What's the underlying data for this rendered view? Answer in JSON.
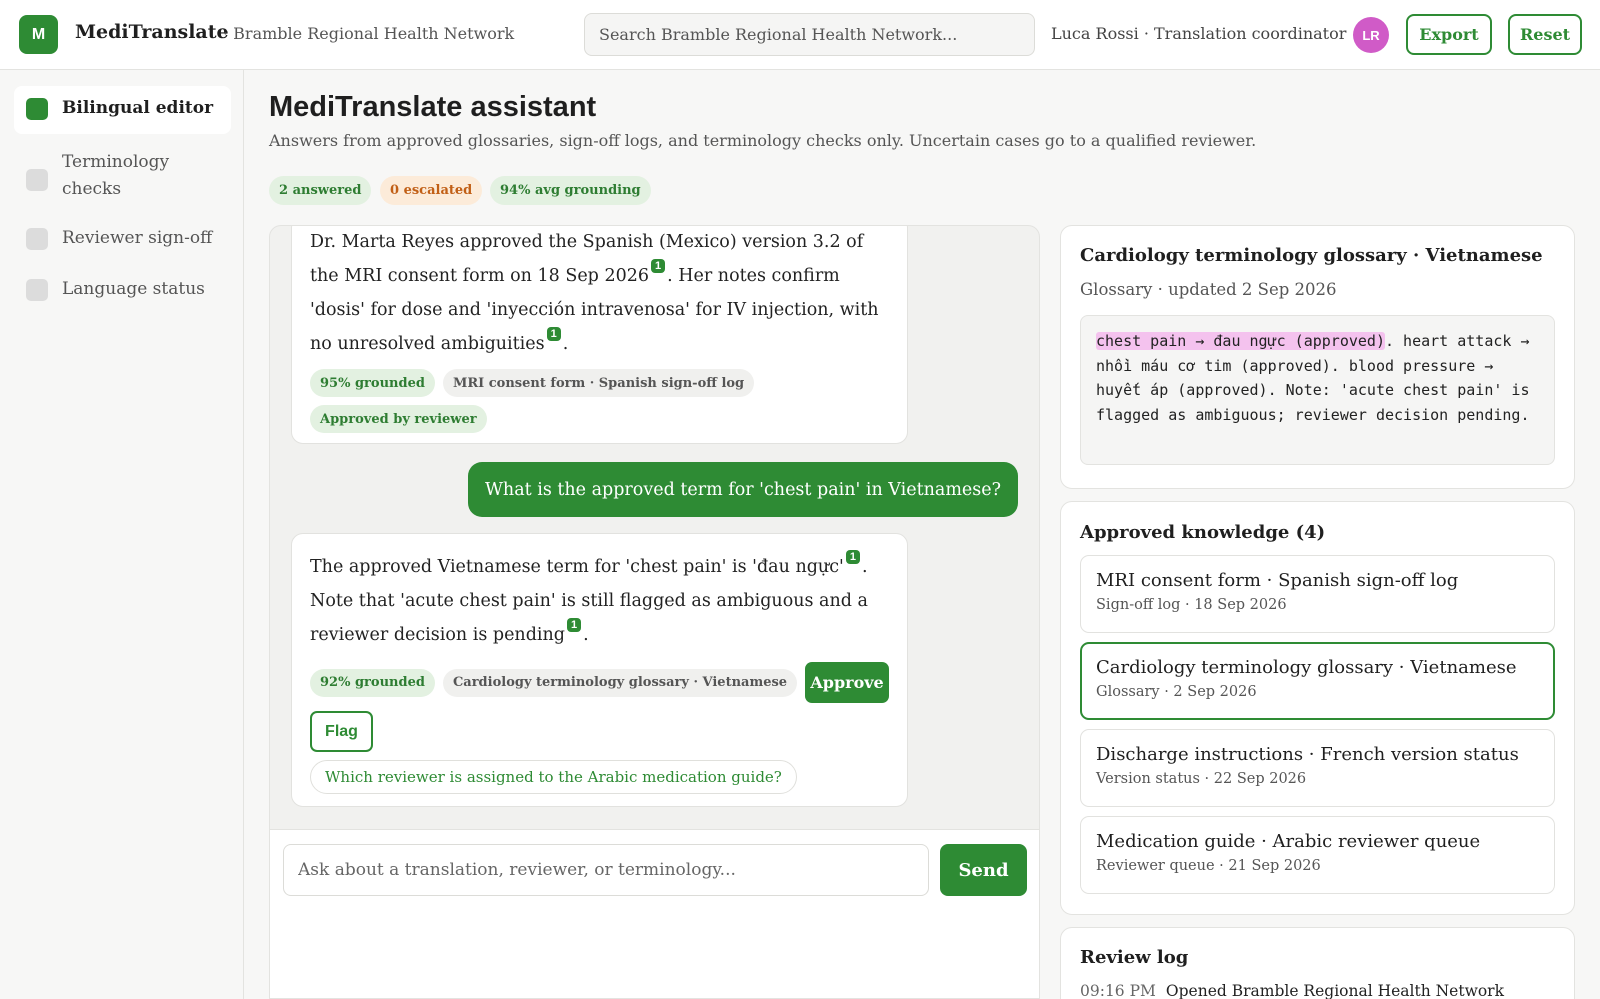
{
  "topbar": {
    "logo_letter": "M",
    "app_name": "MediTranslate",
    "org_name": "· Bramble Regional Health Network",
    "search_placeholder": "Search Bramble Regional Health Network...",
    "user_label": "Luca Rossi · Translation coordinator",
    "avatar_initials": "LR",
    "export_label": "Export",
    "reset_label": "Reset"
  },
  "sidebar": {
    "items": [
      {
        "label": "Bilingual editor",
        "active": true
      },
      {
        "label": "Terminology checks",
        "active": false
      },
      {
        "label": "Reviewer sign-off",
        "active": false
      },
      {
        "label": "Language status",
        "active": false
      }
    ]
  },
  "header": {
    "title": "MediTranslate assistant",
    "subtitle": "Answers from approved glossaries, sign-off logs, and terminology checks only. Uncertain cases go to a qualified reviewer.",
    "stats": {
      "answered": "2 answered",
      "escalated": "0 escalated",
      "grounding": "94% avg grounding"
    }
  },
  "chat": {
    "msg1": {
      "part1": "Dr. Marta Reyes approved the Spanish (Mexico) version 3.2 of the MRI consent form on 18 Sep 2026",
      "cite1": "1",
      "part2": ". Her notes confirm 'dosis' for dose and 'inyección intravenosa' for IV injection, with no unresolved ambiguities",
      "cite2": "1",
      "part3": ".",
      "grounded": "95% grounded",
      "source": "MRI consent form · Spanish sign-off log",
      "status": "Approved by reviewer"
    },
    "user_question": "What is the approved term for 'chest pain' in Vietnamese?",
    "msg2": {
      "part1": "The approved Vietnamese term for 'chest pain' is 'đau ngực'",
      "cite1": "1",
      "part2": ". Note that 'acute chest pain' is still flagged as ambiguous and a reviewer decision is pending",
      "cite2": "1",
      "part3": ".",
      "grounded": "92% grounded",
      "source": "Cardiology terminology glossary · Vietnamese",
      "approve_label": "Approve",
      "flag_label": "Flag",
      "suggestion": "Which reviewer is assigned to the Arabic medication guide?"
    },
    "composer_placeholder": "Ask about a translation, reviewer, or terminology...",
    "send_label": "Send"
  },
  "glossary_card": {
    "title": "Cardiology terminology glossary · Vietnamese",
    "subtitle": "Glossary · updated 2 Sep 2026",
    "highlight": "chest pain → đau ngực (approved)",
    "rest": ". heart attack → nhồi máu cơ tim (approved). blood pressure → huyết áp (approved). Note: 'acute chest pain' is flagged as ambiguous; reviewer decision pending."
  },
  "knowledge": {
    "title": "Approved knowledge (4)",
    "items": [
      {
        "title": "MRI consent form · Spanish sign-off log",
        "meta": "Sign-off log · 18 Sep 2026",
        "selected": false
      },
      {
        "title": "Cardiology terminology glossary · Vietnamese",
        "meta": "Glossary · 2 Sep 2026",
        "selected": true
      },
      {
        "title": "Discharge instructions · French version status",
        "meta": "Version status · 22 Sep 2026",
        "selected": false
      },
      {
        "title": "Medication guide · Arabic reviewer queue",
        "meta": "Reviewer queue · 21 Sep 2026",
        "selected": false
      }
    ]
  },
  "review_log": {
    "title": "Review log",
    "entries": [
      {
        "time": "09:16 PM",
        "text": "Opened Bramble Regional Health Network"
      }
    ]
  },
  "colors": {
    "accent": "#2e8b34",
    "avatar": "#d05bc7",
    "highlight": "#f4c2ee",
    "escalated_bg": "#fcebd9",
    "escalated_text": "#c15f16"
  }
}
